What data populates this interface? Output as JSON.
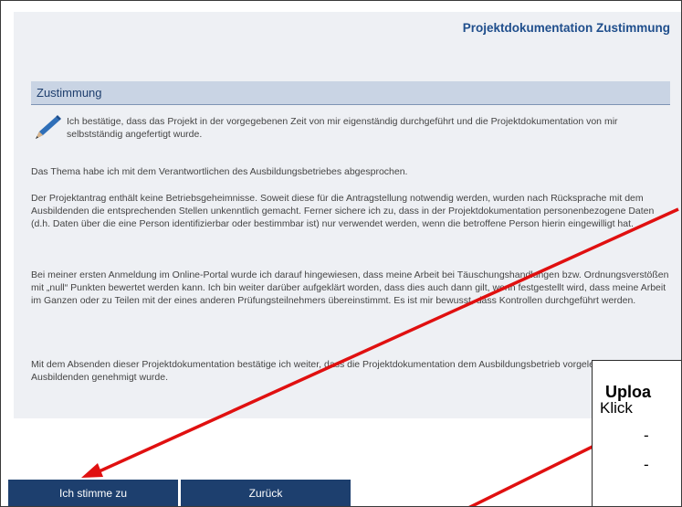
{
  "header": {
    "title": "Projektdokumentation Zustimmung"
  },
  "section": {
    "title": "Zustimmung"
  },
  "content": {
    "intro": "Ich bestätige, dass das Projekt in der vorgegebenen Zeit von mir eigenständig durchgeführt und die Projektdokumentation von mir selbstständig angefertigt wurde.",
    "p1": "Das Thema habe ich mit dem Verantwortlichen des Ausbildungsbetriebes abgesprochen.",
    "p2": "Der Projektantrag enthält keine Betriebsgeheimnisse. Soweit diese für die Antragstellung notwendig werden, wurden nach Rücksprache mit dem Ausbildenden die entsprechenden Stellen unkenntlich gemacht. Ferner sichere ich zu, dass in der Projektdokumentation personenbezogene Daten (d.h. Daten über die eine Person identifizierbar oder bestimmbar ist) nur verwendet werden, wenn die betroffene Person hierin eingewilligt hat.",
    "p3": "Bei meiner ersten Anmeldung im Online-Portal wurde ich darauf hingewiesen, dass meine Arbeit bei Täuschungshandlungen bzw. Ordnungsverstößen mit „null“ Punkten bewertet werden kann. Ich bin weiter darüber aufgeklärt worden, dass dies auch dann gilt, wenn festgestellt wird, dass meine Arbeit im Ganzen oder zu Teilen mit der eines anderen Prüfungsteilnehmers übereinstimmt. Es ist mir bewusst, dass Kontrollen durchgeführt werden.",
    "p4": "Mit dem Absenden dieser Projektdokumentation bestätige ich weiter, dass die Projektdokumentation dem Ausbildungsbetrieb vorgelegt und von dem Ausbildenden genehmigt wurde."
  },
  "buttons": {
    "agree": "Ich stimme zu",
    "back": "Zurück"
  },
  "callout": {
    "title": "Uploa",
    "line": "Klick",
    "dash1": "-",
    "dash2": "-"
  },
  "colors": {
    "accent": "#1d3f6e",
    "annotation": "#e01010",
    "header_bg": "#c9d4e4"
  },
  "icons": {
    "intro": "pencil-icon"
  }
}
